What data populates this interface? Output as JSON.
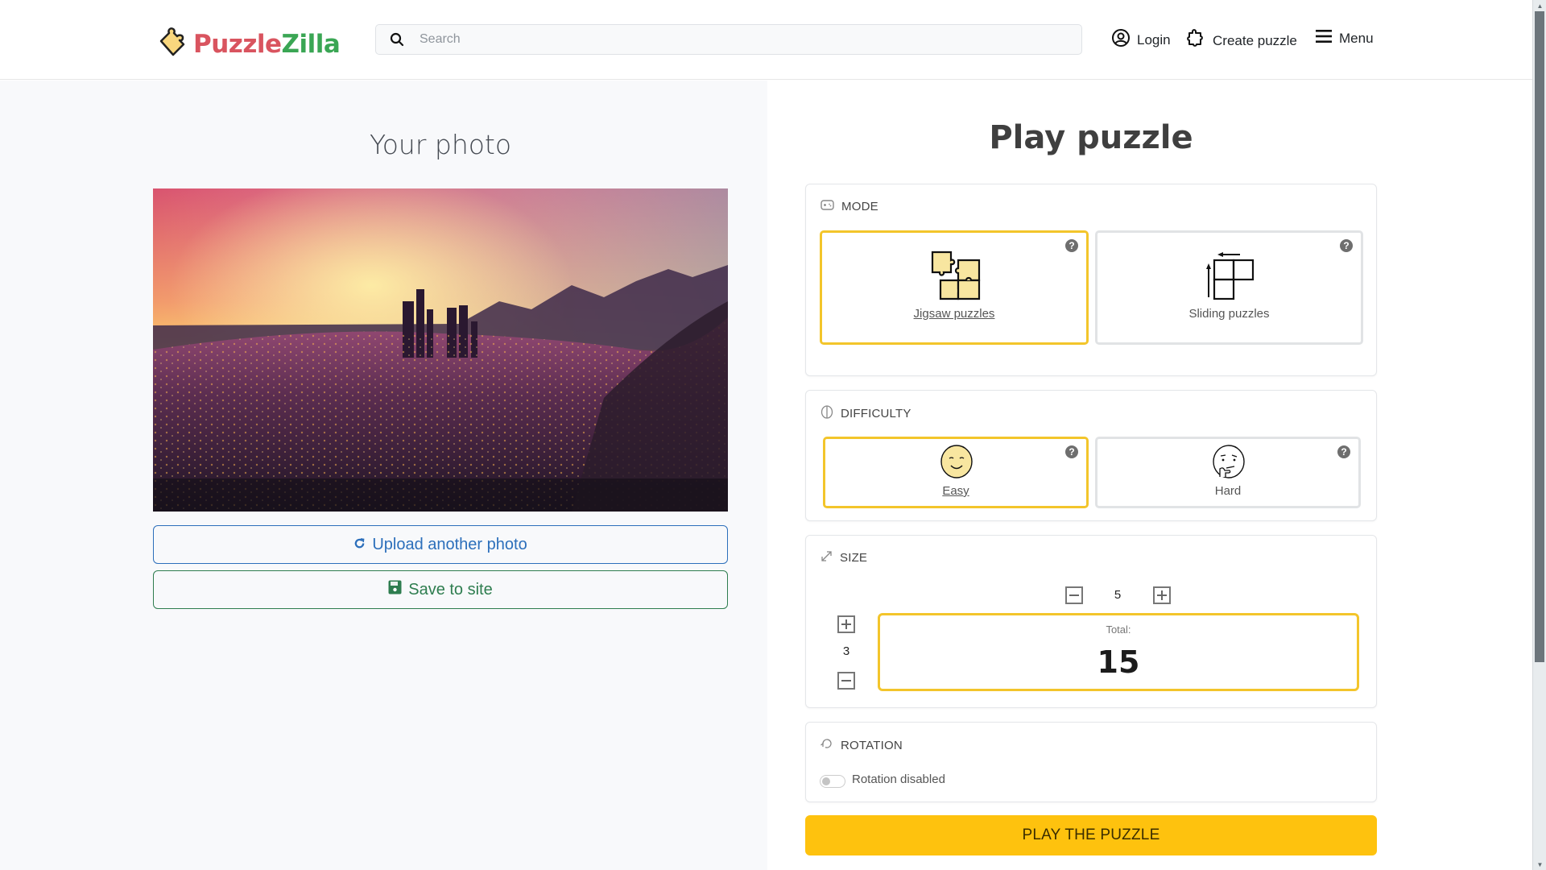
{
  "header": {
    "logo_part1": "Puzzle",
    "logo_part2": "Zilla",
    "search_placeholder": "Search",
    "search_value": "",
    "nav": {
      "login": "Login",
      "create_puzzle": "Create puzzle",
      "menu": "Menu"
    }
  },
  "left": {
    "title": "Your photo",
    "photo_alt": "Sunset aerial view of a city with skyscrapers and mountains",
    "upload_label": "Upload another photo",
    "save_label": "Save to site"
  },
  "right": {
    "title": "Play puzzle",
    "mode": {
      "title": "MODE",
      "options": [
        {
          "label": "Jigsaw puzzles",
          "selected": true,
          "help": "?"
        },
        {
          "label": "Sliding puzzles",
          "selected": false,
          "help": "?"
        }
      ]
    },
    "difficulty": {
      "title": "DIFFICULTY",
      "options": [
        {
          "label": "Easy",
          "selected": true,
          "help": "?"
        },
        {
          "label": "Hard",
          "selected": false,
          "help": "?"
        }
      ]
    },
    "size": {
      "title": "SIZE",
      "columns": "5",
      "rows": "3",
      "total_label": "Total:",
      "total_value": "15"
    },
    "rotation": {
      "title": "ROTATION",
      "enabled": false,
      "toggle_label": "Rotation disabled"
    },
    "play_button": "PLAY THE PUZZLE"
  },
  "colors": {
    "accent_yellow": "#fec20e",
    "selected_border": "#f3c52b",
    "upload_blue": "#2c6fbb",
    "save_green": "#2e7d4f",
    "logo_red": "#d9545f",
    "logo_green": "#3aa654"
  }
}
